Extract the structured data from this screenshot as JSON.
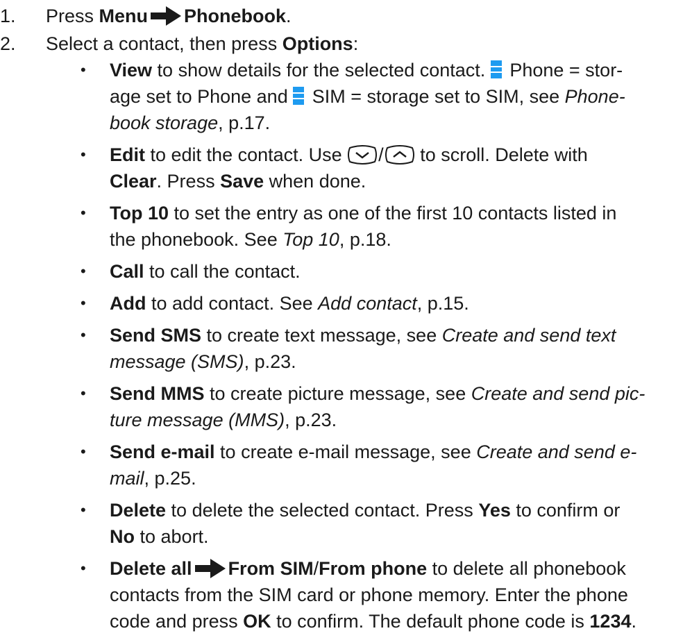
{
  "steps": [
    {
      "num": "1.",
      "a": "Press ",
      "menu": "Menu",
      "phonebook": "Phonebook",
      "end": "."
    },
    {
      "num": "2.",
      "a": "Select a contact, then press ",
      "options": "Options",
      "end": ":"
    }
  ],
  "bullet_char": "•",
  "bullets": {
    "view": {
      "label": "View",
      "t1": " to show details for the selected contact. ",
      "t2": " Phone = stor-",
      "t3": "age set to Phone and ",
      "t4": " SIM = storage set to SIM, see ",
      "ref": "Phone-",
      "ref2": "book storage",
      "t5": ", p.17."
    },
    "edit": {
      "label": "Edit",
      "t1": " to edit the contact. Use ",
      "sep": "/",
      "t2": " to scroll. Delete with",
      "clear": "Clear",
      "t3": ". Press ",
      "save": "Save",
      "t4": " when done."
    },
    "top10": {
      "label": "Top 10",
      "t1": " to set the entry as one of the first 10 contacts listed in",
      "t2": "the phonebook. See ",
      "ref": "Top 10",
      "t3": ", p.18."
    },
    "call": {
      "label": "Call",
      "t1": " to call the contact."
    },
    "add": {
      "label": "Add",
      "t1": " to add contact. See ",
      "ref": "Add contact",
      "t2": ", p.15."
    },
    "sms": {
      "label": "Send SMS",
      "t1": " to create text message, see ",
      "ref1": "Create and send text",
      "ref2": "message (SMS)",
      "t2": ", p.23."
    },
    "mms": {
      "label": "Send MMS",
      "t1": " to create picture message, see ",
      "ref1": "Create and send pic-",
      "ref2": "ture message (MMS)",
      "t2": ", p.23."
    },
    "email": {
      "label": "Send e-mail",
      "t1": " to create e-mail message, see ",
      "ref1": "Create and send e-",
      "ref2": "mail",
      "t2": ", p.25."
    },
    "delete": {
      "label": "Delete",
      "t1": " to delete the selected contact. Press ",
      "yes": "Yes",
      "t2": " to confirm or",
      "no": "No",
      "t3": " to abort."
    },
    "delete_all": {
      "label": "Delete all",
      "from_sim": "From SIM",
      "sep": "/",
      "from_phone": "From phone",
      "t1": " to delete all phonebook",
      "t2": "contacts from the SIM card or phone memory. Enter the phone",
      "t3": "code and press ",
      "ok": "OK",
      "t4": " to confirm. The default phone code is ",
      "code": "1234",
      "t5": "."
    }
  },
  "colors": {
    "text": "#1a1a1a",
    "storage_icon": "#1e9bf0"
  },
  "icons": {
    "arrow": "right-arrow-icon",
    "storage": "storage-icon",
    "scroll_down": "scroll-down-key-icon",
    "scroll_up": "scroll-up-key-icon"
  }
}
